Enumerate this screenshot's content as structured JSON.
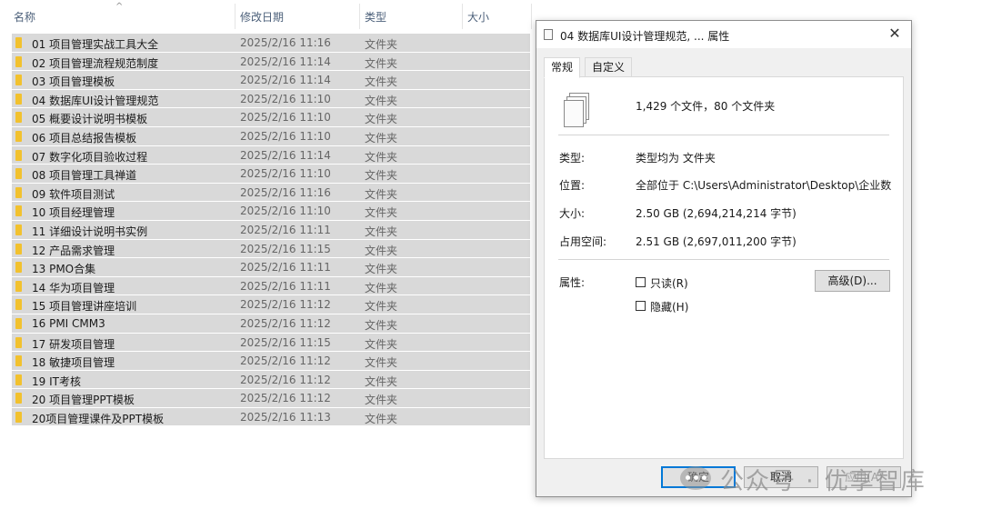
{
  "columns": {
    "name": "名称",
    "modified": "修改日期",
    "type": "类型",
    "size": "大小"
  },
  "sort_indicator": "^",
  "rows": [
    {
      "name": "01 项目管理实战工具大全",
      "date": "2025/2/16 11:16",
      "type": "文件夹"
    },
    {
      "name": "02 项目管理流程规范制度",
      "date": "2025/2/16 11:14",
      "type": "文件夹"
    },
    {
      "name": "03 项目管理模板",
      "date": "2025/2/16 11:14",
      "type": "文件夹"
    },
    {
      "name": "04 数据库UI设计管理规范",
      "date": "2025/2/16 11:10",
      "type": "文件夹"
    },
    {
      "name": "05 概要设计说明书模板",
      "date": "2025/2/16 11:10",
      "type": "文件夹"
    },
    {
      "name": "06 项目总结报告模板",
      "date": "2025/2/16 11:10",
      "type": "文件夹"
    },
    {
      "name": "07 数字化项目验收过程",
      "date": "2025/2/16 11:14",
      "type": "文件夹"
    },
    {
      "name": "08 项目管理工具禅道",
      "date": "2025/2/16 11:10",
      "type": "文件夹"
    },
    {
      "name": "09 软件项目测试",
      "date": "2025/2/16 11:16",
      "type": "文件夹"
    },
    {
      "name": "10 项目经理管理",
      "date": "2025/2/16 11:10",
      "type": "文件夹"
    },
    {
      "name": "11 详细设计说明书实例",
      "date": "2025/2/16 11:11",
      "type": "文件夹"
    },
    {
      "name": "12 产品需求管理",
      "date": "2025/2/16 11:15",
      "type": "文件夹"
    },
    {
      "name": "13 PMO合集",
      "date": "2025/2/16 11:11",
      "type": "文件夹"
    },
    {
      "name": "14 华为项目管理",
      "date": "2025/2/16 11:11",
      "type": "文件夹"
    },
    {
      "name": "15 项目管理讲座培训",
      "date": "2025/2/16 11:12",
      "type": "文件夹"
    },
    {
      "name": "16 PMI CMM3",
      "date": "2025/2/16 11:12",
      "type": "文件夹"
    },
    {
      "name": "17 研发项目管理",
      "date": "2025/2/16 11:15",
      "type": "文件夹"
    },
    {
      "name": "18 敏捷项目管理",
      "date": "2025/2/16 11:12",
      "type": "文件夹"
    },
    {
      "name": "19 IT考核",
      "date": "2025/2/16 11:12",
      "type": "文件夹"
    },
    {
      "name": "20 项目管理PPT模板",
      "date": "2025/2/16 11:12",
      "type": "文件夹"
    },
    {
      "name": "20项目管理课件及PPT模板",
      "date": "2025/2/16 11:13",
      "type": "文件夹"
    }
  ],
  "dialog": {
    "title": "04 数据库UI设计管理规范, ... 属性",
    "close": "✕",
    "tabs": [
      "常规",
      "自定义"
    ],
    "summary": "1,429 个文件，80 个文件夹",
    "fields": {
      "type_label": "类型:",
      "type_value": "类型均为 文件夹",
      "location_label": "位置:",
      "location_value": "全部位于 C:\\Users\\Administrator\\Desktop\\企业数字化",
      "size_label": "大小:",
      "size_value": "2.50 GB (2,694,214,214 字节)",
      "disk_label": "占用空间:",
      "disk_value": "2.51 GB (2,697,011,200 字节)",
      "attr_label": "属性:"
    },
    "checkboxes": {
      "readonly": "只读(R)",
      "hidden": "隐藏(H)"
    },
    "advanced_button": "高级(D)...",
    "ok_button": "确定",
    "cancel_button": "取消",
    "apply_button": "应用(A)"
  },
  "watermark": "公众号 · 优享智库",
  "colors": {
    "selection": "#d9d9d9",
    "folder": "#f2c12e",
    "accent": "#0078d7"
  }
}
